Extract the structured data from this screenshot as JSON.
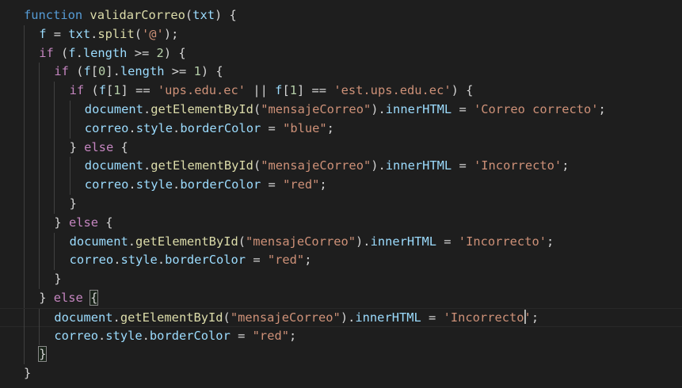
{
  "editor": {
    "language": "javascript",
    "colors": {
      "background": "#1e1e1e",
      "keyword": "#569cd6",
      "control": "#c586c0",
      "function": "#dcdcaa",
      "variable": "#9cdcfe",
      "string": "#ce9178",
      "number": "#b5cea8",
      "punctuation": "#d4d4d4"
    },
    "current_line": 17,
    "lines": [
      {
        "indent": 0,
        "tokens": [
          [
            "kw",
            "function"
          ],
          [
            "pun",
            " "
          ],
          [
            "fn",
            "validarCorreo"
          ],
          [
            "pun",
            "("
          ],
          [
            "var",
            "txt"
          ],
          [
            "pun",
            ") {"
          ]
        ]
      },
      {
        "indent": 1,
        "tokens": [
          [
            "var",
            "f"
          ],
          [
            "pun",
            " = "
          ],
          [
            "var",
            "txt"
          ],
          [
            "pun",
            "."
          ],
          [
            "fn",
            "split"
          ],
          [
            "pun",
            "("
          ],
          [
            "str",
            "'@'"
          ],
          [
            "pun",
            ");"
          ]
        ]
      },
      {
        "indent": 1,
        "tokens": [
          [
            "ctl",
            "if"
          ],
          [
            "pun",
            " ("
          ],
          [
            "var",
            "f"
          ],
          [
            "pun",
            "."
          ],
          [
            "var",
            "length"
          ],
          [
            "pun",
            " >= "
          ],
          [
            "num",
            "2"
          ],
          [
            "pun",
            ") {"
          ]
        ]
      },
      {
        "indent": 2,
        "tokens": [
          [
            "ctl",
            "if"
          ],
          [
            "pun",
            " ("
          ],
          [
            "var",
            "f"
          ],
          [
            "pun",
            "["
          ],
          [
            "num",
            "0"
          ],
          [
            "pun",
            "]."
          ],
          [
            "var",
            "length"
          ],
          [
            "pun",
            " >= "
          ],
          [
            "num",
            "1"
          ],
          [
            "pun",
            ") {"
          ]
        ]
      },
      {
        "indent": 3,
        "tokens": [
          [
            "ctl",
            "if"
          ],
          [
            "pun",
            " ("
          ],
          [
            "var",
            "f"
          ],
          [
            "pun",
            "["
          ],
          [
            "num",
            "1"
          ],
          [
            "pun",
            "] == "
          ],
          [
            "str",
            "'ups.edu.ec'"
          ],
          [
            "pun",
            " || "
          ],
          [
            "var",
            "f"
          ],
          [
            "pun",
            "["
          ],
          [
            "num",
            "1"
          ],
          [
            "pun",
            "] == "
          ],
          [
            "str",
            "'est.ups.edu.ec'"
          ],
          [
            "pun",
            ") {"
          ]
        ]
      },
      {
        "indent": 4,
        "tokens": [
          [
            "var",
            "document"
          ],
          [
            "pun",
            "."
          ],
          [
            "fn",
            "getElementById"
          ],
          [
            "pun",
            "("
          ],
          [
            "str",
            "\"mensajeCorreo\""
          ],
          [
            "pun",
            ")."
          ],
          [
            "var",
            "innerHTML"
          ],
          [
            "pun",
            " = "
          ],
          [
            "str",
            "'Correo correcto'"
          ],
          [
            "pun",
            ";"
          ]
        ]
      },
      {
        "indent": 4,
        "tokens": [
          [
            "var",
            "correo"
          ],
          [
            "pun",
            "."
          ],
          [
            "var",
            "style"
          ],
          [
            "pun",
            "."
          ],
          [
            "var",
            "borderColor"
          ],
          [
            "pun",
            " = "
          ],
          [
            "str",
            "\"blue\""
          ],
          [
            "pun",
            ";"
          ]
        ]
      },
      {
        "indent": 3,
        "tokens": [
          [
            "pun",
            "} "
          ],
          [
            "ctl",
            "else"
          ],
          [
            "pun",
            " {"
          ]
        ]
      },
      {
        "indent": 4,
        "tokens": [
          [
            "var",
            "document"
          ],
          [
            "pun",
            "."
          ],
          [
            "fn",
            "getElementById"
          ],
          [
            "pun",
            "("
          ],
          [
            "str",
            "\"mensajeCorreo\""
          ],
          [
            "pun",
            ")."
          ],
          [
            "var",
            "innerHTML"
          ],
          [
            "pun",
            " = "
          ],
          [
            "str",
            "'Incorrecto'"
          ],
          [
            "pun",
            ";"
          ]
        ]
      },
      {
        "indent": 4,
        "tokens": [
          [
            "var",
            "correo"
          ],
          [
            "pun",
            "."
          ],
          [
            "var",
            "style"
          ],
          [
            "pun",
            "."
          ],
          [
            "var",
            "borderColor"
          ],
          [
            "pun",
            " = "
          ],
          [
            "str",
            "\"red\""
          ],
          [
            "pun",
            ";"
          ]
        ]
      },
      {
        "indent": 3,
        "tokens": [
          [
            "pun",
            "}"
          ]
        ]
      },
      {
        "indent": 2,
        "tokens": [
          [
            "pun",
            "} "
          ],
          [
            "ctl",
            "else"
          ],
          [
            "pun",
            " {"
          ]
        ]
      },
      {
        "indent": 3,
        "tokens": [
          [
            "var",
            "document"
          ],
          [
            "pun",
            "."
          ],
          [
            "fn",
            "getElementById"
          ],
          [
            "pun",
            "("
          ],
          [
            "str",
            "\"mensajeCorreo\""
          ],
          [
            "pun",
            ")."
          ],
          [
            "var",
            "innerHTML"
          ],
          [
            "pun",
            " = "
          ],
          [
            "str",
            "'Incorrecto'"
          ],
          [
            "pun",
            ";"
          ]
        ]
      },
      {
        "indent": 3,
        "tokens": [
          [
            "var",
            "correo"
          ],
          [
            "pun",
            "."
          ],
          [
            "var",
            "style"
          ],
          [
            "pun",
            "."
          ],
          [
            "var",
            "borderColor"
          ],
          [
            "pun",
            " = "
          ],
          [
            "str",
            "\"red\""
          ],
          [
            "pun",
            ";"
          ]
        ]
      },
      {
        "indent": 2,
        "tokens": [
          [
            "pun",
            "}"
          ]
        ]
      },
      {
        "indent": 1,
        "tokens": [
          [
            "pun",
            "} "
          ],
          [
            "ctl",
            "else"
          ],
          [
            "pun",
            " "
          ],
          [
            "match",
            "{"
          ]
        ]
      },
      {
        "indent": 2,
        "tokens": [
          [
            "var",
            "document"
          ],
          [
            "pun",
            "."
          ],
          [
            "fn",
            "getElementById"
          ],
          [
            "pun",
            "("
          ],
          [
            "str",
            "\"mensajeCorreo\""
          ],
          [
            "pun",
            ")."
          ],
          [
            "var",
            "innerHTML"
          ],
          [
            "pun",
            " = "
          ],
          [
            "str",
            "'Incorrecto"
          ],
          [
            "caret",
            ""
          ],
          [
            "str",
            "'"
          ],
          [
            "pun",
            ";"
          ]
        ]
      },
      {
        "indent": 2,
        "tokens": [
          [
            "var",
            "correo"
          ],
          [
            "pun",
            "."
          ],
          [
            "var",
            "style"
          ],
          [
            "pun",
            "."
          ],
          [
            "var",
            "borderColor"
          ],
          [
            "pun",
            " = "
          ],
          [
            "str",
            "\"red\""
          ],
          [
            "pun",
            ";"
          ]
        ]
      },
      {
        "indent": 1,
        "tokens": [
          [
            "match",
            "}"
          ]
        ]
      },
      {
        "indent": 0,
        "tokens": [
          [
            "pun",
            "}"
          ]
        ]
      }
    ]
  }
}
